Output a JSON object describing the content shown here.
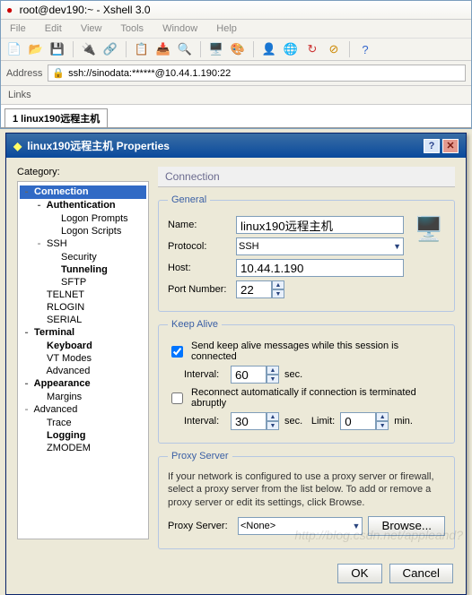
{
  "main": {
    "title": "root@dev190:~ - Xshell 3.0",
    "menus": [
      "File",
      "Edit",
      "View",
      "Tools",
      "Window",
      "Help"
    ],
    "address_label": "Address",
    "address_value": "ssh://sinodata:******@10.44.1.190:22",
    "links_label": "Links",
    "tab_label": "1 linux190远程主机"
  },
  "dialog": {
    "title": "linux190远程主机 Properties",
    "category_label": "Category:",
    "section_head": "Connection",
    "tree": [
      {
        "l": 0,
        "t": "Connection",
        "tw": "-",
        "bold": true,
        "sel": true
      },
      {
        "l": 1,
        "t": "Authentication",
        "tw": "-",
        "bold": true
      },
      {
        "l": 2,
        "t": "Logon Prompts"
      },
      {
        "l": 2,
        "t": "Logon Scripts"
      },
      {
        "l": 1,
        "t": "SSH",
        "tw": "-"
      },
      {
        "l": 2,
        "t": "Security"
      },
      {
        "l": 2,
        "t": "Tunneling",
        "bold": true
      },
      {
        "l": 2,
        "t": "SFTP"
      },
      {
        "l": 1,
        "t": "TELNET"
      },
      {
        "l": 1,
        "t": "RLOGIN"
      },
      {
        "l": 1,
        "t": "SERIAL"
      },
      {
        "l": 0,
        "t": "Terminal",
        "tw": "-",
        "bold": true
      },
      {
        "l": 1,
        "t": "Keyboard",
        "bold": true
      },
      {
        "l": 1,
        "t": "VT Modes"
      },
      {
        "l": 1,
        "t": "Advanced"
      },
      {
        "l": 0,
        "t": "Appearance",
        "tw": "-",
        "bold": true
      },
      {
        "l": 1,
        "t": "Margins"
      },
      {
        "l": 0,
        "t": "Advanced",
        "tw": "-"
      },
      {
        "l": 1,
        "t": "Trace"
      },
      {
        "l": 1,
        "t": "Logging",
        "bold": true
      },
      {
        "l": 1,
        "t": "ZMODEM"
      }
    ],
    "general": {
      "legend": "General",
      "name_label": "Name:",
      "name_value": "linux190远程主机",
      "protocol_label": "Protocol:",
      "protocol_value": "SSH",
      "host_label": "Host:",
      "host_value": "10.44.1.190",
      "port_label": "Port Number:",
      "port_value": "22"
    },
    "keepalive": {
      "legend": "Keep Alive",
      "send_label": "Send keep alive messages while this session is connected",
      "send_checked": true,
      "interval_label": "Interval:",
      "interval1": "60",
      "sec": "sec.",
      "reconnect_label": "Reconnect automatically if connection is terminated abruptly",
      "reconnect_checked": false,
      "interval2": "30",
      "limit_label": "Limit:",
      "limit_value": "0",
      "min": "min."
    },
    "proxy": {
      "legend": "Proxy Server",
      "text": "If your network is configured to use a proxy server or firewall, select a proxy server from the list below. To add or remove a proxy server or edit its settings, click Browse.",
      "label": "Proxy Server:",
      "value": "<None>",
      "browse": "Browse..."
    },
    "buttons": {
      "ok": "OK",
      "cancel": "Cancel"
    }
  },
  "watermark": "http://blog.csdn.net/appleand?"
}
